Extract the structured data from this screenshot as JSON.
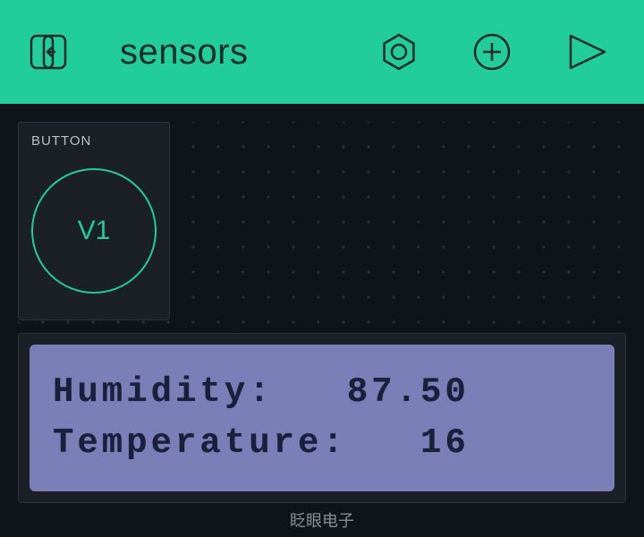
{
  "header": {
    "title": "sensors"
  },
  "buttonWidget": {
    "label": "BUTTON",
    "pin": "V1"
  },
  "lcd": {
    "line1": "Humidity:   87.50",
    "line2": "Temperature:   16"
  },
  "footer": {
    "credit": "眨眼电子"
  },
  "colors": {
    "accent": "#21ce99",
    "bg": "#0f1419",
    "panel": "#1a2026",
    "lcd": "#7a7fb8"
  }
}
